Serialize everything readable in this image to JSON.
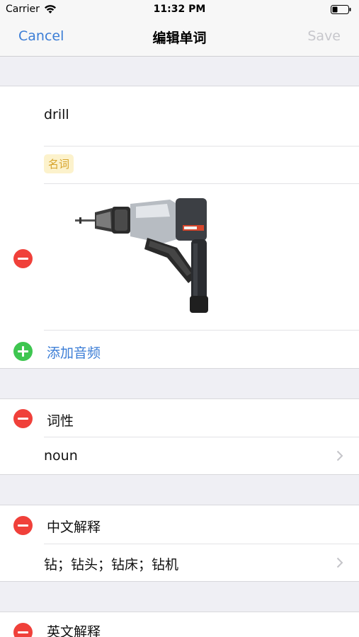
{
  "status_bar": {
    "carrier": "Carrier",
    "time": "11:32 PM",
    "battery_icon": "battery-icon",
    "wifi_icon": "wifi-icon"
  },
  "nav": {
    "cancel_label": "Cancel",
    "title": "编辑单词",
    "save_label": "Save",
    "accent_color": "#3b7dd6",
    "disabled_color": "#c7c7cc"
  },
  "word_section": {
    "word": "drill",
    "pos_tag": "名词",
    "image_alt": "power drill",
    "add_audio_label": "添加音频"
  },
  "pos_section": {
    "header": "词性",
    "value": "noun"
  },
  "chinese_section": {
    "header": "中文解释",
    "value": "钻；钻头；钻床；钻机"
  },
  "english_section": {
    "header": "英文解释"
  },
  "icons": {
    "remove": "minus-circle-icon",
    "add": "plus-circle-icon",
    "disclosure": "chevron-right-icon"
  },
  "colors": {
    "remove": "#f0403a",
    "add": "#3ec650",
    "tag_bg": "#fcf2cc",
    "tag_text": "#d7a32a"
  }
}
